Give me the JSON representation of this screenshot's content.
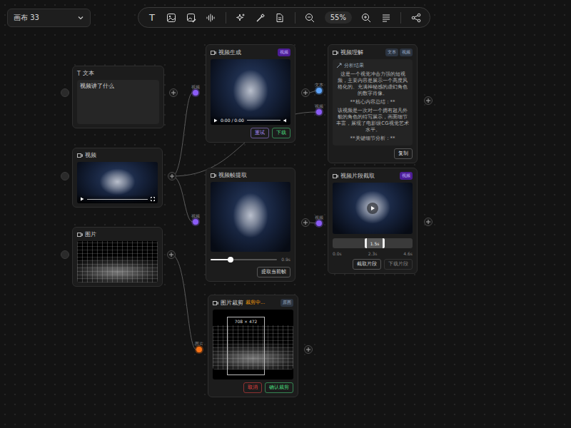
{
  "canvas_selector": {
    "label": "画布 33"
  },
  "toolbar": {
    "text_tool": "T",
    "zoom": "55%"
  },
  "ports": [
    {
      "label": "视频",
      "color": "#8b5cf6"
    },
    {
      "label": "视频",
      "color": "#8b5cf6"
    },
    {
      "label": "图片",
      "color": "#f97316"
    },
    {
      "label": "文本",
      "color": "#60a5fa"
    },
    {
      "label": "视频",
      "color": "#8b5cf6"
    },
    {
      "label": "视频",
      "color": "#8b5cf6"
    }
  ],
  "nodes": [
    {
      "kind": "text",
      "icon": "T",
      "title": "文本",
      "value": "视频讲了什么"
    },
    {
      "kind": "video",
      "title": "视频"
    },
    {
      "kind": "image",
      "title": "图片"
    },
    {
      "kind": "player",
      "title": "视频生成",
      "badge": "视频",
      "time": "0:00 / 0:00",
      "buttons": [
        {
          "label": "重试",
          "color": "#a78bfa"
        },
        {
          "label": "下载",
          "color": "#4ade80"
        }
      ]
    },
    {
      "kind": "frame",
      "title": "视频帧提取",
      "level": 0.3,
      "reading": "0.9s",
      "button": "提取当前帧"
    },
    {
      "kind": "crop",
      "title": "图片裁剪",
      "status": "裁剪中...",
      "badge": "原图",
      "size": "708 × 472",
      "buttons": [
        {
          "label": "取消",
          "color": "#ef4444"
        },
        {
          "label": "确认裁剪",
          "color": "#4ade80"
        }
      ]
    },
    {
      "kind": "analysis",
      "title": "视频理解",
      "badges": [
        "文本",
        "视频"
      ],
      "subtitle": "分析结果",
      "paragraphs": [
        "这是一个视觉冲击力强的短视频，主要内容是展示一个高度风格化的、充满神秘感的虚幻角色的数字肖像。",
        "**核心内容总结：**",
        "该视频是一次对一个拥有超凡外貌的角色的特写展示，画面细节丰富，展现了电影级CG视觉艺术水平。",
        "**关键细节分析：**"
      ],
      "button": "复制"
    },
    {
      "kind": "clip",
      "title": "视频片段截取",
      "badge": "视频",
      "start": 0.4,
      "end": 0.6,
      "range_label": "1.5s",
      "ticks": [
        "0.0s",
        "2.3s",
        "4.6s"
      ],
      "buttons": [
        "截取片段",
        "下载片段"
      ]
    }
  ]
}
